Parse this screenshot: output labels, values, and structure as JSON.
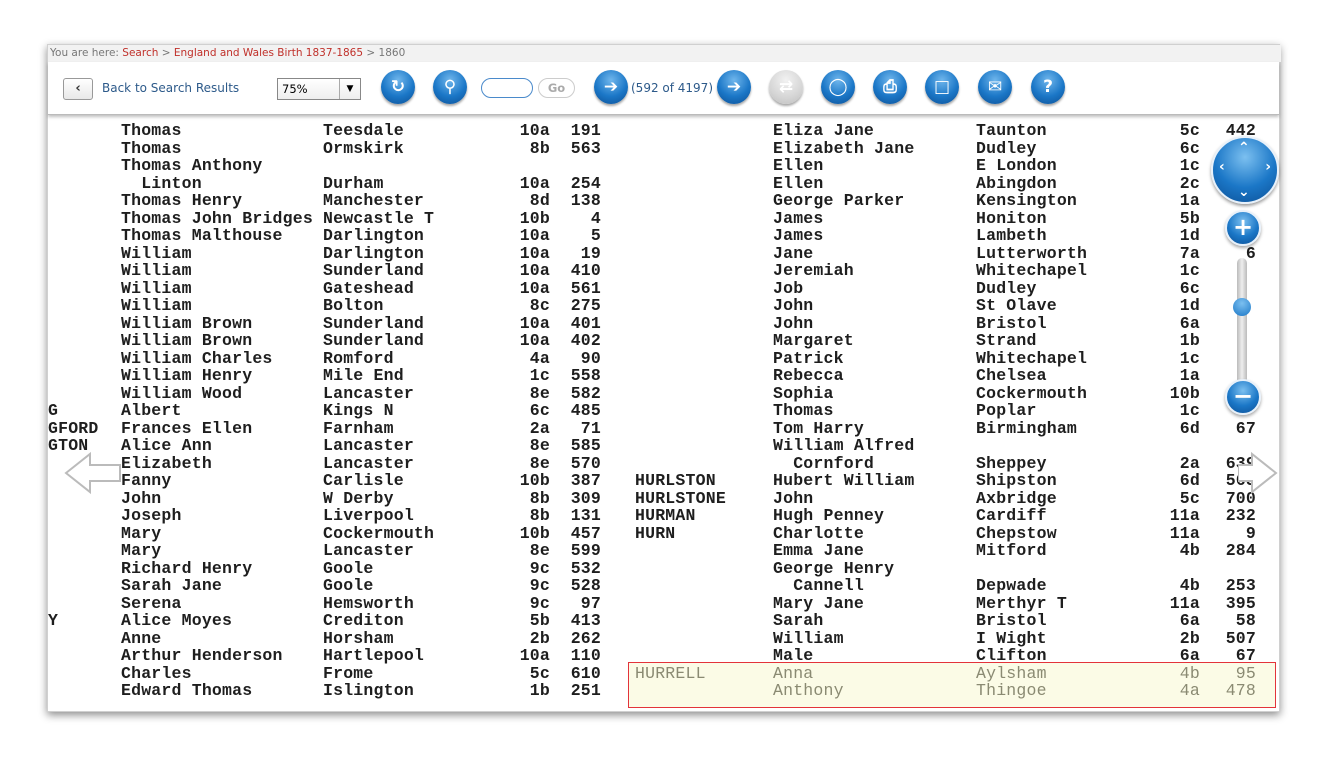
{
  "breadcrumb": {
    "prefix": "You are here:",
    "items": [
      "Search",
      "England and Wales Birth 1837-1865",
      "1860"
    ],
    "sep": ">"
  },
  "toolbar": {
    "back_label": "Back to Search Results",
    "zoom_value": "75%",
    "page_input_value": "",
    "go_label": "Go",
    "page_count": "(592 of 4197)"
  },
  "colors": {
    "accent": "#1b77c7",
    "link": "#c0302a",
    "highlight_border": "#e3333a",
    "highlight_bg": "#fbfbe6"
  },
  "left_rows": [
    [
      "",
      "Thomas",
      "Teesdale",
      "10a",
      "191"
    ],
    [
      "",
      "Thomas",
      "Ormskirk",
      "8b",
      "563"
    ],
    [
      "",
      "Thomas Anthony",
      "",
      "",
      ""
    ],
    [
      "",
      "  Linton",
      "Durham",
      "10a",
      "254"
    ],
    [
      "",
      "Thomas Henry",
      "Manchester",
      "8d",
      "138"
    ],
    [
      "",
      "Thomas John Bridges",
      "Newcastle T",
      "10b",
      "4"
    ],
    [
      "",
      "Thomas Malthouse",
      "Darlington",
      "10a",
      "5"
    ],
    [
      "",
      "William",
      "Darlington",
      "10a",
      "19"
    ],
    [
      "",
      "William",
      "Sunderland",
      "10a",
      "410"
    ],
    [
      "",
      "William",
      "Gateshead",
      "10a",
      "561"
    ],
    [
      "",
      "William",
      "Bolton",
      "8c",
      "275"
    ],
    [
      "",
      "William Brown",
      "Sunderland",
      "10a",
      "401"
    ],
    [
      "",
      "William Brown",
      "Sunderland",
      "10a",
      "402"
    ],
    [
      "",
      "William Charles",
      "Romford",
      "4a",
      "90"
    ],
    [
      "",
      "William Henry",
      "Mile End",
      "1c",
      "558"
    ],
    [
      "",
      "William Wood",
      "Lancaster",
      "8e",
      "582"
    ],
    [
      "G",
      "Albert",
      "Kings N",
      "6c",
      "485"
    ],
    [
      "GFORD",
      "Frances Ellen",
      "Farnham",
      "2a",
      "71"
    ],
    [
      "GTON",
      "Alice Ann",
      "Lancaster",
      "8e",
      "585"
    ],
    [
      "",
      "Elizabeth",
      "Lancaster",
      "8e",
      "570"
    ],
    [
      "",
      "Fanny",
      "Carlisle",
      "10b",
      "387"
    ],
    [
      "",
      "John",
      "W Derby",
      "8b",
      "309"
    ],
    [
      "",
      "Joseph",
      "Liverpool",
      "8b",
      "131"
    ],
    [
      "",
      "Mary",
      "Cockermouth",
      "10b",
      "457"
    ],
    [
      "",
      "Mary",
      "Lancaster",
      "8e",
      "599"
    ],
    [
      "",
      "Richard Henry",
      "Goole",
      "9c",
      "532"
    ],
    [
      "",
      "Sarah Jane",
      "Goole",
      "9c",
      "528"
    ],
    [
      "",
      "Serena",
      "Hemsworth",
      "9c",
      "97"
    ],
    [
      "Y",
      "Alice Moyes",
      "Crediton",
      "5b",
      "413"
    ],
    [
      "",
      "Anne",
      "Horsham",
      "2b",
      "262"
    ],
    [
      "",
      "Arthur Henderson",
      "Hartlepool",
      "10a",
      "110"
    ],
    [
      "",
      "Charles",
      "Frome",
      "5c",
      "610"
    ],
    [
      "",
      "Edward Thomas",
      "Islington",
      "1b",
      "251"
    ]
  ],
  "right_rows": [
    [
      "",
      "Eliza Jane",
      "Taunton",
      "5c",
      "442"
    ],
    [
      "",
      "Elizabeth Jane",
      "Dudley",
      "6c",
      ""
    ],
    [
      "",
      "Ellen",
      "E London",
      "1c",
      ""
    ],
    [
      "",
      "Ellen",
      "Abingdon",
      "2c",
      ""
    ],
    [
      "",
      "George Parker",
      "Kensington",
      "1a",
      ""
    ],
    [
      "",
      "James",
      "Honiton",
      "5b",
      ""
    ],
    [
      "",
      "James",
      "Lambeth",
      "1d",
      ""
    ],
    [
      "",
      "Jane",
      "Lutterworth",
      "7a",
      "6"
    ],
    [
      "",
      "Jeremiah",
      "Whitechapel",
      "1c",
      ""
    ],
    [
      "",
      "Job",
      "Dudley",
      "6c",
      ""
    ],
    [
      "",
      "John",
      "St Olave",
      "1d",
      ""
    ],
    [
      "",
      "John",
      "Bristol",
      "6a",
      ""
    ],
    [
      "",
      "Margaret",
      "Strand",
      "1b",
      ""
    ],
    [
      "",
      "Patrick",
      "Whitechapel",
      "1c",
      ""
    ],
    [
      "",
      "Rebecca",
      "Chelsea",
      "1a",
      ""
    ],
    [
      "",
      "Sophia",
      "Cockermouth",
      "10b",
      ""
    ],
    [
      "",
      "Thomas",
      "Poplar",
      "1c",
      ""
    ],
    [
      "",
      "Tom Harry",
      "Birmingham",
      "6d",
      "67"
    ],
    [
      "",
      "William Alfred",
      "",
      "",
      ""
    ],
    [
      "",
      "  Cornford",
      "Sheppey",
      "2a",
      "639"
    ],
    [
      "HURLSTON",
      "Hubert William",
      "Shipston",
      "6d",
      "565"
    ],
    [
      "HURLSTONE",
      "John",
      "Axbridge",
      "5c",
      "700"
    ],
    [
      "HURMAN",
      "Hugh Penney",
      "Cardiff",
      "11a",
      "232"
    ],
    [
      "HURN",
      "Charlotte",
      "Chepstow",
      "11a",
      "9"
    ],
    [
      "",
      "Emma Jane",
      "Mitford",
      "4b",
      "284"
    ],
    [
      "",
      "George Henry",
      "",
      "",
      ""
    ],
    [
      "",
      "  Cannell",
      "Depwade",
      "4b",
      "253"
    ],
    [
      "",
      "Mary Jane",
      "Merthyr T",
      "11a",
      "395"
    ],
    [
      "",
      "Sarah",
      "Bristol",
      "6a",
      "58"
    ],
    [
      "",
      "William",
      "I Wight",
      "2b",
      "507"
    ],
    [
      "",
      "Male",
      "Clifton",
      "6a",
      "67"
    ],
    [
      "HURRELL",
      "Anna",
      "Aylsham",
      "4b",
      "95"
    ],
    [
      "",
      "Anthony",
      "Thingoe",
      "4a",
      "478"
    ]
  ],
  "highlighted_rows": [
    31,
    32
  ],
  "icons": {
    "back": "chevron-left-icon",
    "rotate": "rotate-icon",
    "search": "magnifier-icon",
    "prev": "arrow-left-icon",
    "next": "arrow-right-icon",
    "sync": "sync-icon",
    "tip": "lightbulb-icon",
    "print": "printer-icon",
    "save": "floppy-icon",
    "email": "envelope-icon",
    "help": "question-icon",
    "zoom_in": "plus-icon",
    "zoom_out": "minus-icon"
  },
  "zoom_slider_level": 0.35
}
